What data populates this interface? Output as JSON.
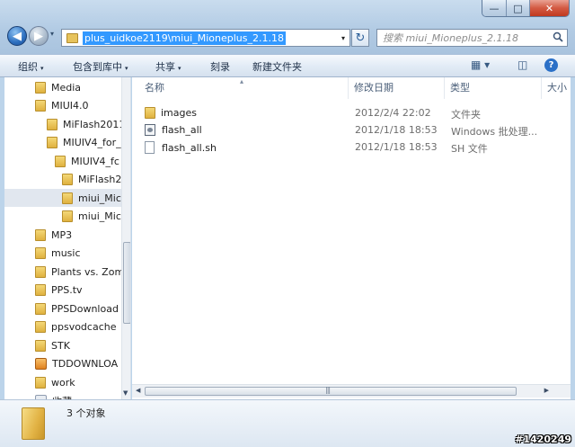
{
  "window": {
    "minimize_glyph": "—",
    "maximize_glyph": "□",
    "close_glyph": "✕"
  },
  "navigation": {
    "back_glyph": "◀",
    "forward_glyph": "▶",
    "recent_glyph": "▾"
  },
  "address_bar": {
    "path": "plus_uidkoe2119\\miui_Mioneplus_2.1.18",
    "dropdown_glyph": "▾",
    "refresh_glyph": "↻"
  },
  "search": {
    "placeholder": "搜索 miui_Mioneplus_2.1.18",
    "icon": "search-icon"
  },
  "toolbar": {
    "organize": "组织",
    "include_in_library": "包含到库中",
    "share": "共享",
    "burn": "刻录",
    "new_folder": "新建文件夹",
    "caret": "▾",
    "views_glyph": "▦ ▾",
    "preview_pane_glyph": "◫",
    "help_glyph": "?"
  },
  "sidebar": {
    "items": [
      {
        "label": "Media",
        "icon": "folder-icon"
      },
      {
        "label": "MIUI4.0",
        "icon": "folder-icon"
      },
      {
        "label": "MiFlash2011",
        "icon": "folder-icon"
      },
      {
        "label": "MIUIV4_for_",
        "icon": "folder-icon"
      },
      {
        "label": "MIUIV4_fc",
        "icon": "folder-icon"
      },
      {
        "label": "MiFlash2",
        "icon": "folder-icon"
      },
      {
        "label": "miui_Mic",
        "icon": "folder-icon",
        "selected": true
      },
      {
        "label": "miui_Mic",
        "icon": "folder-icon"
      },
      {
        "label": "MP3",
        "icon": "folder-icon"
      },
      {
        "label": "music",
        "icon": "folder-icon"
      },
      {
        "label": "Plants vs. Zom",
        "icon": "folder-icon"
      },
      {
        "label": "PPS.tv",
        "icon": "folder-icon"
      },
      {
        "label": "PPSDownload",
        "icon": "folder-icon"
      },
      {
        "label": "ppsvodcache",
        "icon": "folder-icon"
      },
      {
        "label": "STK",
        "icon": "folder-icon"
      },
      {
        "label": "TDDOWNLOA",
        "icon": "app-icon"
      },
      {
        "label": "work",
        "icon": "folder-icon"
      },
      {
        "label": "收藏",
        "icon": "star-icon"
      }
    ],
    "scroll_down_glyph": "▼"
  },
  "file_list": {
    "columns": {
      "name": "名称",
      "modified": "修改日期",
      "type": "类型",
      "size": "大小",
      "sort_glyph": "▴"
    },
    "rows": [
      {
        "name": "images",
        "modified": "2012/2/4 22:02",
        "type": "文件夹",
        "icon": "folder-icon"
      },
      {
        "name": "flash_all",
        "modified": "2012/1/18 18:53",
        "type": "Windows 批处理...",
        "icon": "batch-file-icon"
      },
      {
        "name": "flash_all.sh",
        "modified": "2012/1/18 18:53",
        "type": "SH 文件",
        "icon": "document-icon"
      }
    ],
    "scroll_left_glyph": "◀",
    "scroll_right_glyph": "▶",
    "grip_glyph": "|||"
  },
  "details_pane": {
    "item_count": "3 个对象"
  },
  "watermark": "#1420249"
}
